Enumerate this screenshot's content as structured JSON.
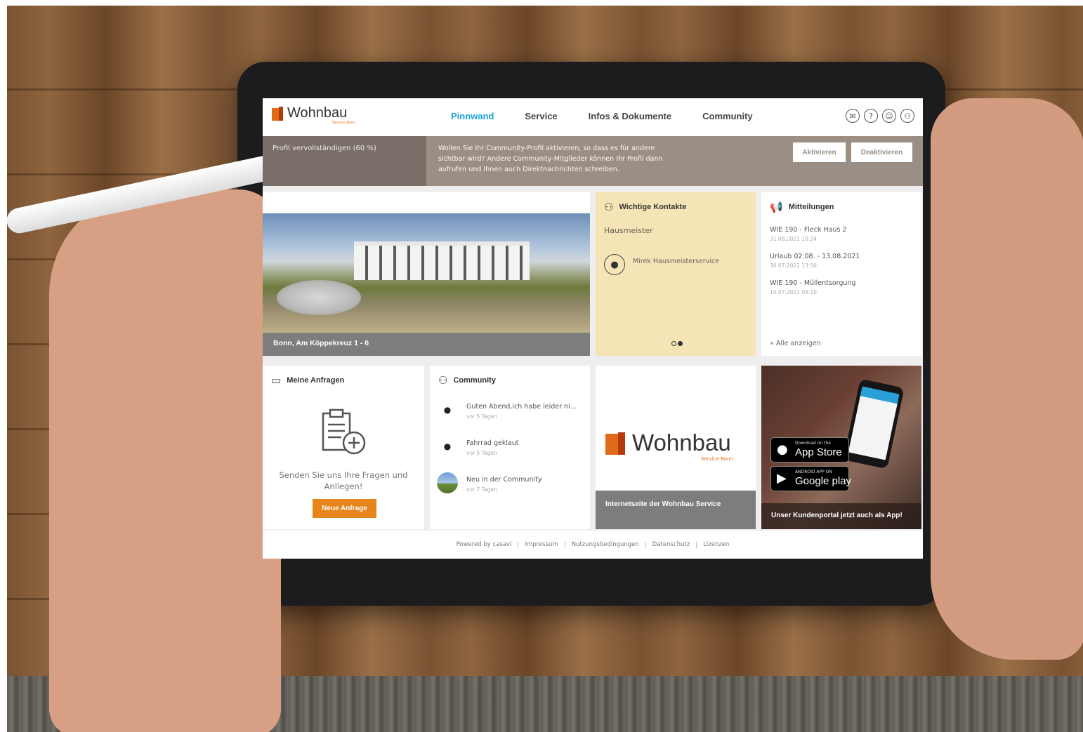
{
  "brand": {
    "name": "Wohnbau",
    "sub": "Service Bonn",
    "accent_color": "#e06a1a",
    "nav_active_color": "#1aa3dc"
  },
  "nav": {
    "items": [
      {
        "label": "Pinnwand"
      },
      {
        "label": "Service"
      },
      {
        "label": "Infos & Dokumente"
      },
      {
        "label": "Community"
      }
    ],
    "icons": [
      "mail-icon",
      "help-icon",
      "chat-icon",
      "user-icon"
    ]
  },
  "banner": {
    "profile": "Profil vervollständigen (60 %)",
    "message": "Wollen Sie Ihr Community-Profil aktivieren, so dass es für andere sichtbar wird? Andere Community-Mitglieder können Ihr Profil dann aufrufen und Ihnen auch Direktnachrichten schreiben.",
    "activate": "Aktivieren",
    "deactivate": "Deaktivieren"
  },
  "photo_card": {
    "caption": "Bonn, Am Köppekreuz 1 - 6"
  },
  "contacts": {
    "title": "Wichtige Kontakte",
    "role": "Hausmeister",
    "name": "Mirek Hausmeisterservice"
  },
  "news": {
    "title": "Mitteilungen",
    "items": [
      {
        "title": "WIE 190 - Fleck Haus 2",
        "date": "31.08.2021 10:24"
      },
      {
        "title": "Urlaub 02.08. - 13.08.2021",
        "date": "30.07.2021 13:56"
      },
      {
        "title": "WIE 190 - Müllentsorgung",
        "date": "14.07.2021 09:10"
      }
    ],
    "show_all": "» Alle anzeigen"
  },
  "requests": {
    "title": "Meine Anfragen",
    "text": "Senden Sie uns Ihre Fragen und Anliegen!",
    "button": "Neue Anfrage"
  },
  "community": {
    "title": "Community",
    "items": [
      {
        "title": "Guten Abend,ich habe leider ni...",
        "date": "vor 5 Tagen"
      },
      {
        "title": "Fahrrad geklaut",
        "date": "vor 5 Tagen"
      },
      {
        "title": "Neu in der Community",
        "date": "vor 7 Tagen"
      }
    ]
  },
  "website": {
    "caption": "Internetseite der Wohnbau Service"
  },
  "app": {
    "appstore_small": "Download on the",
    "appstore_big": "App Store",
    "google_small": "ANDROID APP ON",
    "google_big": "Google play",
    "caption": "Unser Kundenportal jetzt auch als App!"
  },
  "footer": {
    "links": [
      "Powered by casavi",
      "Impressum",
      "Nutzungsbedingungen",
      "Datenschutz",
      "Lizenzen"
    ]
  }
}
